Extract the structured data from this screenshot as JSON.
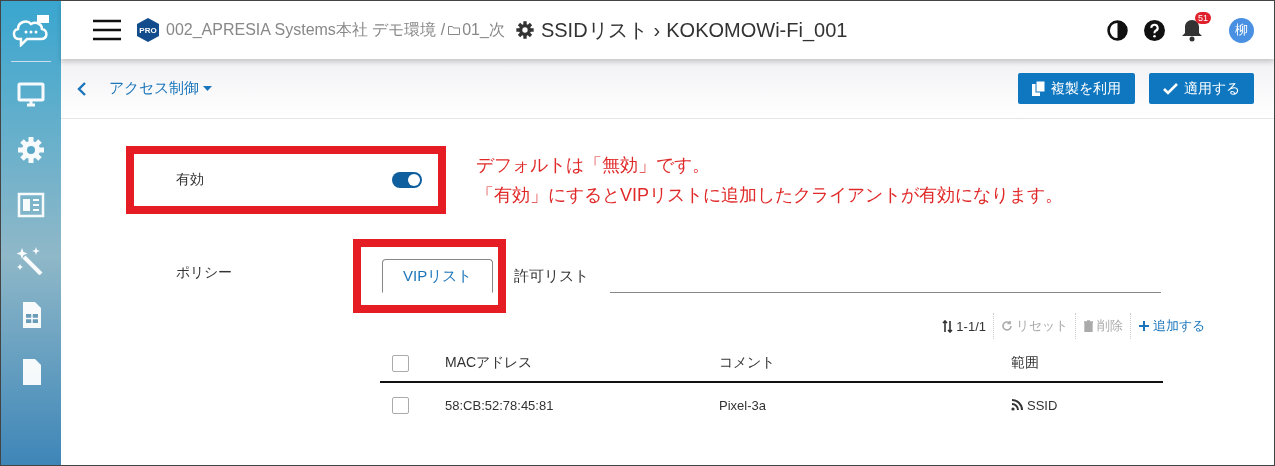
{
  "sidebar": {
    "items": [
      {
        "kind": "monitor",
        "selected": false
      },
      {
        "kind": "gear",
        "selected": false
      },
      {
        "kind": "panel",
        "selected": false
      },
      {
        "kind": "wand",
        "selected": false
      },
      {
        "kind": "sim",
        "selected": false
      },
      {
        "kind": "doc",
        "selected": false
      }
    ]
  },
  "header": {
    "plan_badge": "PRO",
    "breadcrumb": "002_APRESIA Systems本社 デモ環境 /",
    "folder": "01_次",
    "title": "SSIDリスト",
    "separator": "›",
    "subtitle": "KOKOMOWi-Fi_001",
    "notification_count": "51",
    "avatar": "柳"
  },
  "subbar": {
    "section": "アクセス制御",
    "buttons": [
      {
        "kind": "copy",
        "label": "複製を利用"
      },
      {
        "kind": "check",
        "label": "適用する"
      }
    ]
  },
  "enable": {
    "label": "有効",
    "on": true
  },
  "annotation": {
    "lines": [
      "デフォルトは「無効」です。",
      "「有効」にするとVIPリストに追加したクライアントが有効になります。"
    ]
  },
  "policy": {
    "label": "ポリシー",
    "tabs": [
      {
        "label": "VIPリスト",
        "selected": true
      },
      {
        "label": "許可リスト",
        "selected": false
      }
    ]
  },
  "toolbar": [
    {
      "kind": "sort",
      "label": "1-1/1",
      "disabled": false
    },
    {
      "kind": "reset",
      "label": "リセット",
      "disabled": true
    },
    {
      "kind": "delete",
      "label": "削除",
      "disabled": true
    },
    {
      "kind": "add",
      "label": "追加する",
      "disabled": false
    }
  ],
  "table": {
    "columns": [
      "MACアドレス",
      "コメント",
      "範囲"
    ],
    "all_checked": false,
    "rows": [
      {
        "checked": false,
        "mac": "58:CB:52:78:45:81",
        "comment": "Pixel-3a",
        "scope": "SSID"
      }
    ]
  }
}
